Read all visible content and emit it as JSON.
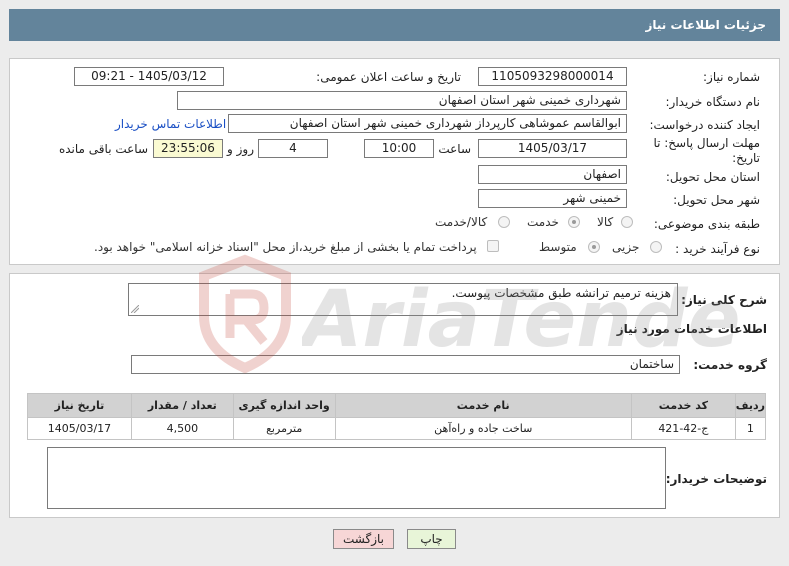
{
  "header": {
    "title": "جزئیات اطلاعات نیاز"
  },
  "form": {
    "need_number_label": "شماره نیاز:",
    "need_number": "1105093298000014",
    "announce_label": "تاریخ و ساعت اعلان عمومی:",
    "announce_value": "1405/03/12 - 09:21",
    "buyer_label": "نام دستگاه خریدار:",
    "buyer_value": "شهرداری خمینی شهر استان اصفهان",
    "creator_label": "ایجاد کننده درخواست:",
    "creator_value": "ابوالقاسم عموشاهی کارپرداز شهرداری خمینی شهر استان اصفهان",
    "contact_link": "اطلاعات تماس خریدار",
    "deadline_label_1": "مهلت ارسال پاسخ: تا",
    "deadline_label_2": "تاریخ:",
    "deadline_date": "1405/03/17",
    "time_label": "ساعت",
    "deadline_time": "10:00",
    "days_value": "4",
    "days_label": "روز و",
    "remaining_value": "23:55:06",
    "remaining_label": "ساعت باقی مانده",
    "province_label": "استان محل تحویل:",
    "province_value": "اصفهان",
    "city_label": "شهر محل تحویل:",
    "city_value": "خمینی شهر",
    "category_label": "طبقه بندی موضوعی:",
    "category_options": [
      "کالا",
      "خدمت",
      "کالا/خدمت"
    ],
    "category_selected": "خدمت",
    "process_label": "نوع فرآیند خرید :",
    "process_options": [
      "جزیی",
      "متوسط"
    ],
    "process_selected": "متوسط",
    "payment_note": "پرداخت تمام یا بخشی از مبلغ خرید،از محل \"اسناد خزانه اسلامی\" خواهد بود."
  },
  "summary": {
    "label": "شرح کلی نیاز:",
    "value": "هزینه ترمیم ترانشه طبق مشخصات پیوست."
  },
  "services": {
    "section_title": "اطلاعات خدمات مورد نیاز",
    "group_label": "گروه خدمت:",
    "group_value": "ساختمان",
    "columns": [
      "ردیف",
      "کد خدمت",
      "نام خدمت",
      "واحد اندازه گیری",
      "تعداد / مقدار",
      "تاریخ نیاز"
    ],
    "rows": [
      {
        "index": "1",
        "code": "ج-42-421",
        "name": "ساخت جاده و راه‌آهن",
        "unit": "مترمربع",
        "qty": "4,500",
        "date": "1405/03/17"
      }
    ]
  },
  "buyer_notes": {
    "label": "توضیحات خریدار:",
    "value": ""
  },
  "buttons": {
    "print": "چاپ",
    "back": "بازگشت"
  },
  "watermark": {
    "text": "AriaTender.neT"
  },
  "colors": {
    "header_bg": "#63849b",
    "link": "#1a4fc4",
    "print_btn": "#e8f5d8",
    "back_btn": "#f7d6d6"
  }
}
